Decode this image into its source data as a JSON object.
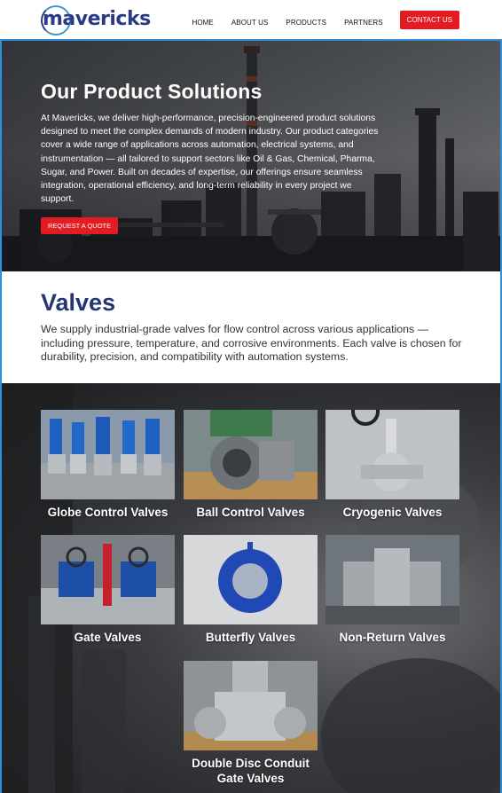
{
  "brand": {
    "logo_text": "mavericks",
    "primary_color": "#2b3a84",
    "accent_color": "#e31b23"
  },
  "nav": {
    "items": [
      "HOME",
      "ABOUT US",
      "PRODUCTS",
      "PARTNERS"
    ],
    "cta": "CONTACT US"
  },
  "hero": {
    "title": "Our Product Solutions",
    "text": "At Mavericks, we deliver high-performance, precision-engineered product solutions designed to meet the complex demands of modern industry. Our product categories cover a wide range of applications across automation, electrical systems, and instrumentation — all tailored to support sectors like Oil & Gas, Chemical, Pharma, Sugar, and Power. Built on decades of expertise, our offerings ensure seamless integration, operational efficiency, and long-term reliability in every project we support.",
    "button": "REQUEST A QUOTE"
  },
  "valves": {
    "title": "Valves",
    "description": "We supply industrial-grade valves for flow control across various applications — including pressure, temperature, and corrosive environments. Each valve is chosen for durability, precision, and compatibility with automation systems.",
    "products": [
      {
        "name": "Globe Control Valves",
        "icon": "globe-valve-photo"
      },
      {
        "name": "Ball Control Valves",
        "icon": "ball-valve-photo"
      },
      {
        "name": "Cryogenic Valves",
        "icon": "cryogenic-valve-photo"
      },
      {
        "name": "Gate Valves",
        "icon": "gate-valve-photo"
      },
      {
        "name": "Butterfly Valves",
        "icon": "butterfly-valve-photo"
      },
      {
        "name": "Non-Return Valves",
        "icon": "non-return-valve-photo"
      },
      {
        "name": "Double Disc Conduit Gate Valves",
        "icon": "double-disc-valve-photo"
      }
    ]
  }
}
